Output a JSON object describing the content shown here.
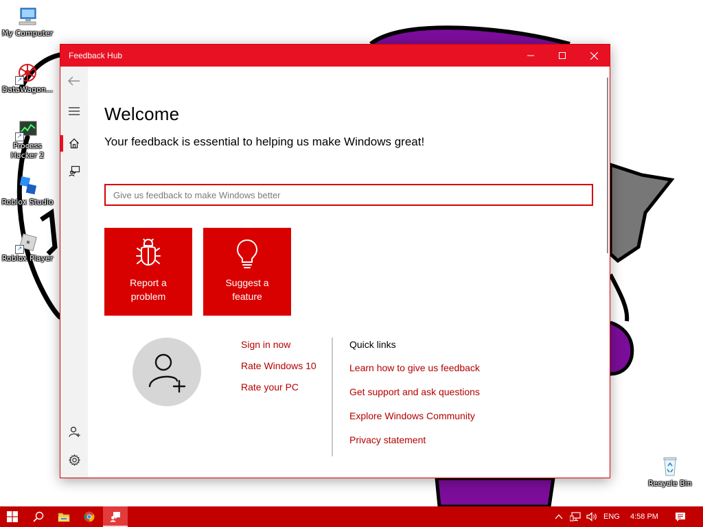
{
  "desktop": {
    "icons": [
      {
        "label": "My Computer",
        "icon": "computer-icon"
      },
      {
        "label": "DataWagon...",
        "icon": "datawagon-icon"
      },
      {
        "label": "Process Hacker 2",
        "icon": "process-hacker-icon"
      },
      {
        "label": "Roblox Studio",
        "icon": "roblox-studio-icon"
      },
      {
        "label": "Roblox Player",
        "icon": "roblox-player-icon"
      },
      {
        "label": "Recycle Bin",
        "icon": "recycle-bin-icon"
      }
    ]
  },
  "window": {
    "title": "Feedback Hub",
    "controls": [
      "minimize-icon",
      "maximize-icon",
      "close-icon"
    ],
    "accent": "#e81123"
  },
  "nav": {
    "items": [
      "back-icon",
      "menu-icon",
      "home-icon",
      "feedback-icon",
      "add-account-icon",
      "settings-icon"
    ],
    "active": "home"
  },
  "main": {
    "heading": "Welcome",
    "subtitle": "Your feedback is essential to helping us make Windows great!",
    "search_placeholder": "Give us feedback to make Windows better",
    "tiles": [
      {
        "line1": "Report a",
        "line2": "problem",
        "icon": "bug-icon"
      },
      {
        "line1": "Suggest a",
        "line2": "feature",
        "icon": "lightbulb-icon"
      }
    ],
    "account_links": [
      "Sign in now",
      "Rate Windows 10",
      "Rate your PC"
    ],
    "quick_links_title": "Quick links",
    "quick_links": [
      "Learn how to give us feedback",
      "Get support and ask questions",
      "Explore Windows Community",
      "Privacy statement"
    ]
  },
  "taskbar": {
    "color": "#c20000",
    "apps": [
      "windows-start-icon",
      "search-icon",
      "file-explorer-icon",
      "chrome-icon",
      "feedback-hub-icon"
    ],
    "language": "ENG",
    "time": "4:58 PM"
  }
}
